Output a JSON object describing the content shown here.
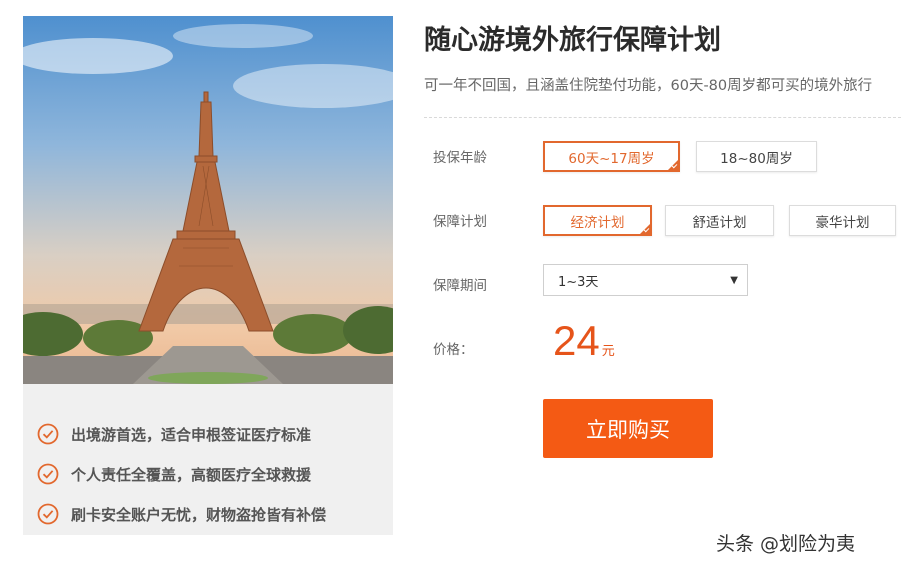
{
  "product": {
    "title": "随心游境外旅行保障计划",
    "subtitle": "可一年不回国，且涵盖住院垫付功能，60天-80周岁都可买的境外旅行"
  },
  "features": [
    {
      "icon": "check-circle-icon",
      "text": "出境游首选，适合申根签证医疗标准"
    },
    {
      "icon": "check-circle-icon",
      "text": "个人责任全覆盖，高额医疗全球救援"
    },
    {
      "icon": "check-circle-icon",
      "text": "刷卡安全账户无忧，财物盗抢皆有补偿"
    }
  ],
  "form": {
    "age": {
      "label": "投保年龄",
      "options": [
        {
          "label": "60天~17周岁",
          "selected": true
        },
        {
          "label": "18~80周岁",
          "selected": false
        }
      ]
    },
    "plan": {
      "label": "保障计划",
      "options": [
        {
          "label": "经济计划",
          "selected": true
        },
        {
          "label": "舒适计划",
          "selected": false
        },
        {
          "label": "豪华计划",
          "selected": false
        }
      ]
    },
    "period": {
      "label": "保障期间",
      "value": "1~3天"
    },
    "price": {
      "label": "价格：",
      "amount": "24",
      "unit": "元"
    }
  },
  "buy_button": {
    "label": "立即购买"
  },
  "watermark": "头条 @划险为夷",
  "colors": {
    "accent": "#e2682e",
    "buy": "#f45a14",
    "price": "#e6541a"
  }
}
